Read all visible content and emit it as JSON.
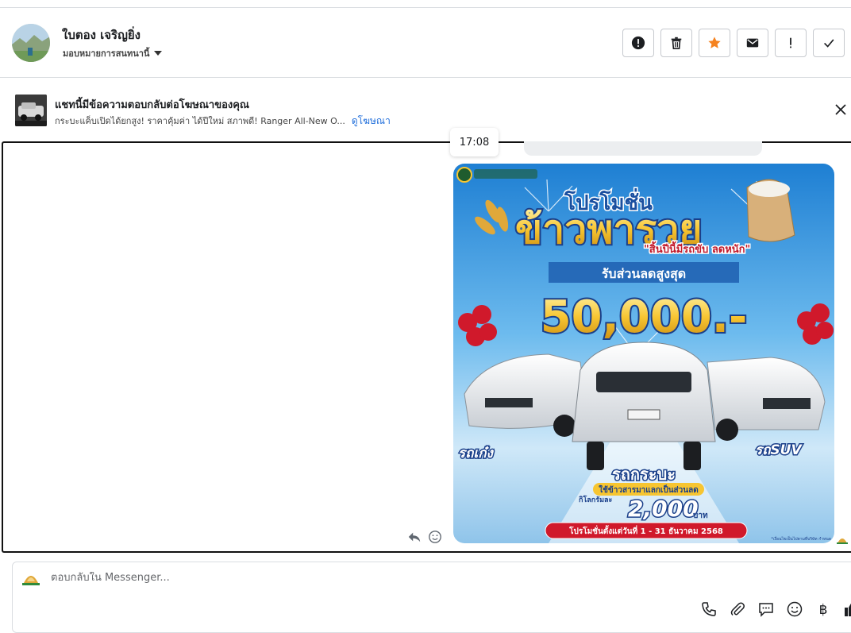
{
  "header": {
    "contact_name": "ใบตอง เจริญยิ่ง",
    "assign_label": "มอบหมายการสนทนานี้",
    "actions": [
      {
        "name": "report-button",
        "icon": "alert-circle-icon"
      },
      {
        "name": "delete-button",
        "icon": "trash-icon"
      },
      {
        "name": "star-button",
        "icon": "star-icon"
      },
      {
        "name": "mark-unread-button",
        "icon": "envelope-icon"
      },
      {
        "name": "mark-important-button",
        "icon": "exclamation-icon"
      },
      {
        "name": "mark-done-button",
        "icon": "checkmark-icon"
      }
    ]
  },
  "ad": {
    "title": "แชทนี้มีข้อความตอบกลับต่อโฆษณาของคุณ",
    "description": "กระบะแค็บเปิดได้ยกสูง! ราคาคุ้มค่า ได้ปีใหม่ สภาพดี! Ranger All-New O...",
    "link_label": "ดูโฆษณา"
  },
  "conversation": {
    "timestamp": "17:08",
    "poster": {
      "headline_small": "โปรโมชั่น",
      "headline_big": "ข้าวพารวย",
      "tagline": "\"สิ้นปีนี้มีรถขับ ลดหนัก\"",
      "discount_label": "รับส่วนลดสูงสุด",
      "discount_amount": "50,000.-",
      "label_sedan": "รถเก๋ง",
      "label_pickup": "รถกระบะ",
      "label_suv": "รถSUV",
      "rice_offer": "ใช้ข้าวสารมาแลกเป็นส่วนลด",
      "per_kg": "กิโลกรัมละ",
      "per_kg_amount": "2,000",
      "per_kg_unit": "บาท",
      "promo_period": "โปรโมชั่นตั้งแต่วันที่ 1 - 31 ธันวาคม 2568",
      "fine_print": "*เงื่อนไขเป็นไปตามที่บริษัท กำหนด"
    }
  },
  "composer": {
    "placeholder": "ตอบกลับใน Messenger..."
  },
  "colors": {
    "accent_orange": "#f5821f",
    "link_blue": "#216fdb",
    "poster_sky": "#2a8fd8",
    "poster_gold": "#f7c531",
    "poster_red": "#d0192b",
    "like_blue": "#0866ff"
  }
}
